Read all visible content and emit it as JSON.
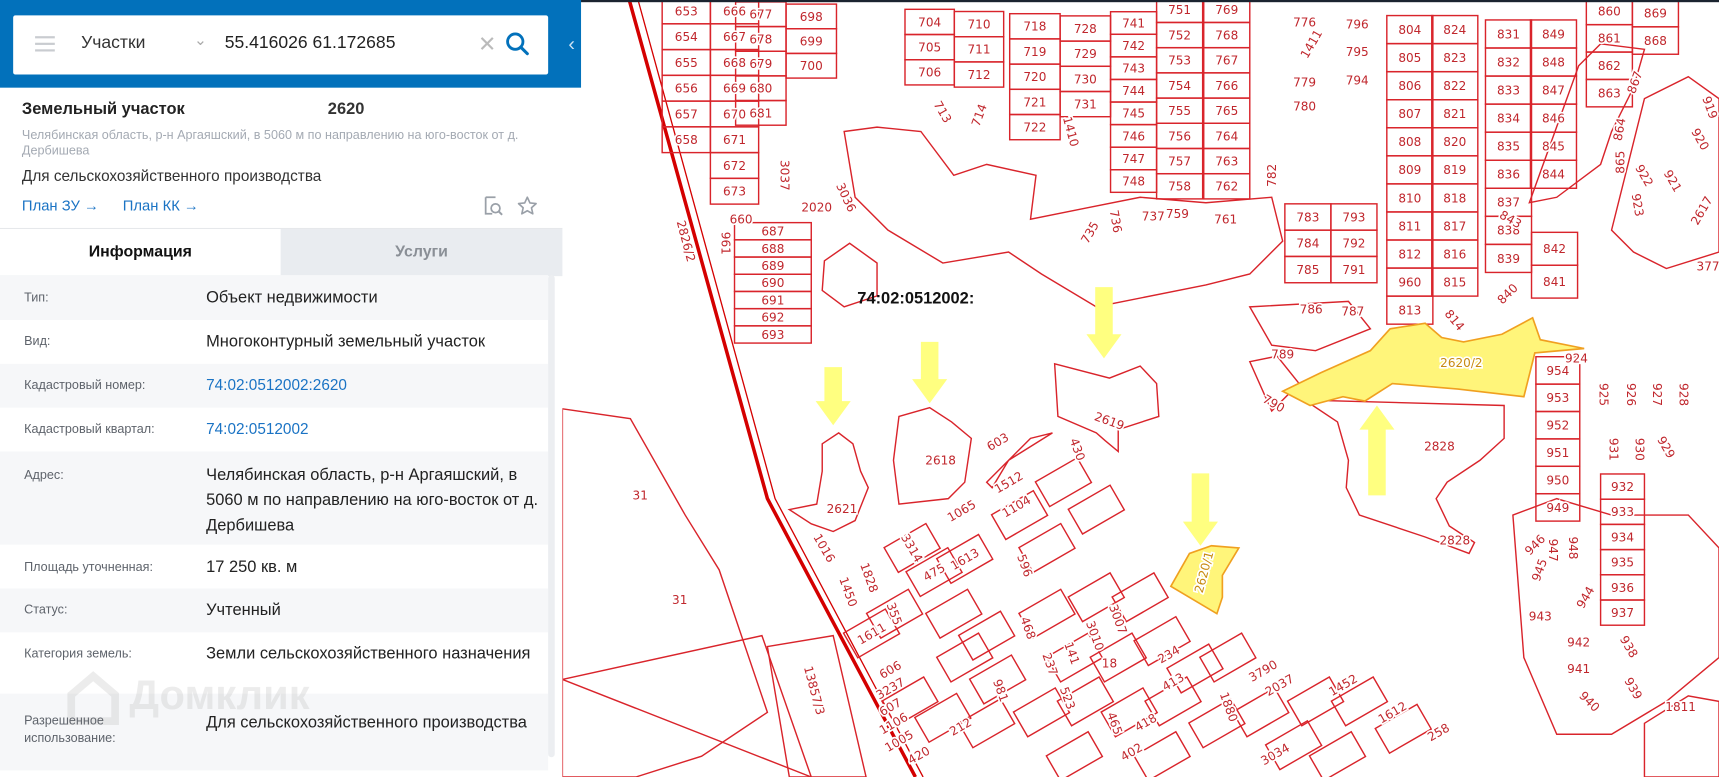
{
  "search": {
    "category": "Участки",
    "query": "55.416026 61.172685"
  },
  "card": {
    "title": "Земельный участок",
    "number": "2620",
    "address": "Челябинская область, р-н Аргаяшский, в 5060 м по направлению на юго-восток от д. Дербишева",
    "purpose": "Для сельскохозяйственного производства",
    "links": [
      "План ЗУ →",
      "План КК →"
    ]
  },
  "tabs": [
    "Информация",
    "Услуги"
  ],
  "info_rows": [
    {
      "label": "Тип:",
      "value": "Объект недвижимости"
    },
    {
      "label": "Вид:",
      "value": "Многоконтурный земельный участок"
    },
    {
      "label": "Кадастровый номер:",
      "value": "74:02:0512002:2620"
    },
    {
      "label": "Кадастровый квартал:",
      "value": "74:02:0512002"
    },
    {
      "label": "Адрес:",
      "value": "Челябинская область, р-н Аргаяшский, в 5060 м по направлению на юго-восток от д. Дербишева"
    },
    {
      "label": "Площадь уточненная:",
      "value": "17 250 кв. м"
    },
    {
      "label": "Статус:",
      "value": "Учтенный"
    },
    {
      "label": "Категория земель:",
      "value": "Земли сельскохозяйственного назначения"
    },
    {
      "label": "Разрешенное использование:",
      "value": "Для сельскохозяйственного производства"
    }
  ],
  "watermark": "Домклик",
  "map": {
    "quarter_label": "74:02:0512002:",
    "highlight_labels": [
      "2620/2",
      "2620/1"
    ],
    "grid_columns": [
      [
        "653",
        "654",
        "655",
        "656",
        "657",
        "658"
      ],
      [
        "666",
        "667",
        "668",
        "669",
        "670",
        "671",
        "672",
        "673"
      ],
      [
        "677",
        "678",
        "679",
        "680",
        "681"
      ],
      [
        "698",
        "699",
        "700"
      ],
      [
        "704",
        "705",
        "706"
      ],
      [
        "710",
        "711",
        "712"
      ],
      [
        "718",
        "719",
        "720",
        "721",
        "722"
      ],
      [
        "728",
        "729",
        "730",
        "731"
      ],
      [
        "741",
        "742",
        "743",
        "744",
        "745",
        "746",
        "747",
        "748"
      ],
      [
        "751",
        "752",
        "753",
        "754",
        "755",
        "756",
        "757",
        "758"
      ],
      [
        "769",
        "768",
        "767",
        "766",
        "765",
        "764",
        "763",
        "762"
      ],
      [
        "804",
        "805",
        "806",
        "807",
        "808",
        "809",
        "810",
        "811",
        "812",
        "960",
        "813"
      ],
      [
        "824",
        "823",
        "822",
        "821",
        "820",
        "819",
        "818",
        "817",
        "816",
        "815"
      ],
      [
        "831",
        "832",
        "833",
        "834",
        "835",
        "836",
        "837",
        "838",
        "839"
      ],
      [
        "849",
        "848",
        "847",
        "846",
        "845",
        "844"
      ],
      [
        "842",
        "841"
      ],
      [
        "860",
        "861",
        "862",
        "863"
      ],
      [
        "869",
        "868"
      ],
      [
        "783",
        "784",
        "785"
      ],
      [
        "793",
        "792",
        "791"
      ],
      [
        "954",
        "953",
        "952",
        "951",
        "950",
        "949"
      ],
      [
        "932",
        "933",
        "934",
        "935",
        "936",
        "937"
      ],
      [
        "687",
        "688",
        "689",
        "690",
        "691",
        "692",
        "693"
      ]
    ],
    "labels": [
      "2619",
      "2618",
      "2621",
      "2828",
      "2828",
      "789",
      "790",
      "603",
      "430",
      "1512",
      "1065",
      "1104",
      "3314",
      "1613",
      "475",
      "596",
      "1016",
      "1828",
      "1450",
      "355",
      "1611",
      "468",
      "3010",
      "3007",
      "141",
      "237",
      "18",
      "234",
      "413",
      "606",
      "3237",
      "607",
      "1106",
      "1005",
      "212",
      "981",
      "523",
      "465",
      "418",
      "402",
      "420",
      "3790",
      "2037",
      "1880",
      "1452",
      "1612",
      "3034",
      "1811",
      "258",
      "13857/3",
      "31",
      "31",
      "2826/2",
      "1410",
      "713",
      "714",
      "3037",
      "3036",
      "2020",
      "660",
      "961",
      "735",
      "736",
      "737",
      "759",
      "761",
      "782",
      "1411",
      "776",
      "779",
      "780",
      "796",
      "795",
      "794",
      "786",
      "787",
      "814",
      "840",
      "843",
      "867",
      "864",
      "865",
      "919",
      "920",
      "921",
      "922",
      "923",
      "2617",
      "377",
      "924",
      "925",
      "926",
      "927",
      "928",
      "931",
      "930",
      "929",
      "938",
      "939",
      "940",
      "941",
      "942",
      "943",
      "944",
      "945",
      "946",
      "947",
      "948"
    ],
    "colors": {
      "parcel": "#d9242b",
      "highlight_fill": "#fff57a",
      "highlight_stroke": "#f0a020",
      "arrow": "#ffff80",
      "road": "#d40000"
    }
  }
}
